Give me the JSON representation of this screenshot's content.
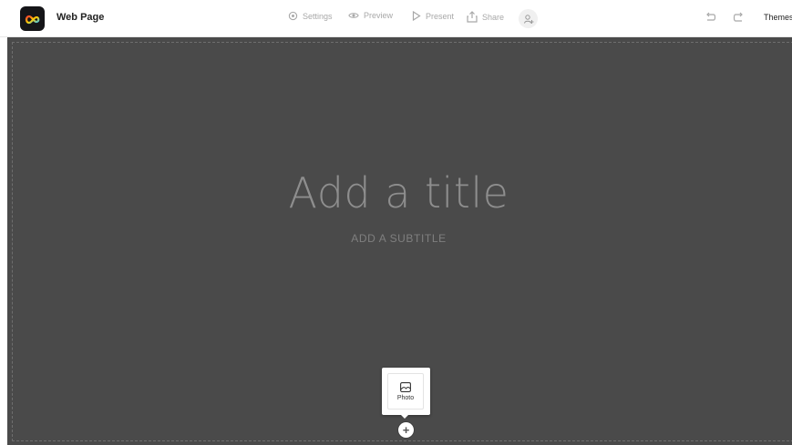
{
  "app": {
    "doc_title": "Web Page",
    "logo_icon": "creative-cloud-logo",
    "brand_colors": [
      "#ff3b30",
      "#ffcc00",
      "#34c7ff"
    ]
  },
  "toolbar": {
    "settings_label": "Settings",
    "preview_label": "Preview",
    "present_label": "Present",
    "share_label": "Share",
    "collaborator_icon": "add-person-icon",
    "undo_icon": "undo-icon",
    "redo_icon": "redo-icon",
    "themes_label": "Themes"
  },
  "canvas": {
    "background_color": "#4a4a4a",
    "title_placeholder": "Add a title",
    "subtitle_placeholder": "ADD A SUBTITLE"
  },
  "insert_menu": {
    "photo_label": "Photo",
    "photo_icon": "image-icon",
    "add_icon": "plus-icon"
  }
}
